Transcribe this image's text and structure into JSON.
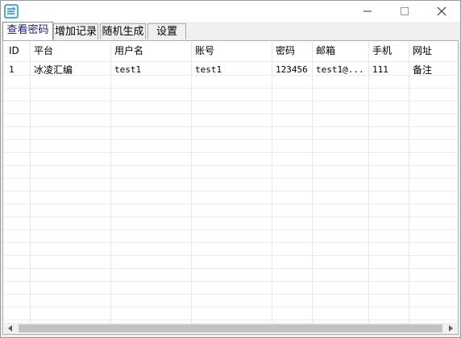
{
  "titlebar": {
    "title": "",
    "icon": "app-icon"
  },
  "tabs": [
    {
      "label": "查看密码",
      "active": true
    },
    {
      "label": "增加记录",
      "active": false
    },
    {
      "label": "随机生成",
      "active": false
    },
    {
      "label": "设置",
      "active": false
    }
  ],
  "table": {
    "columns": [
      "ID",
      "平台",
      "用户名",
      "账号",
      "密码",
      "邮箱",
      "手机",
      "网址"
    ],
    "rows": [
      [
        "1",
        "冰凌汇编",
        "test1",
        "test1",
        "123456",
        "test1@...",
        "111",
        "备注"
      ]
    ]
  },
  "colors": {
    "tab_active_text": "#1a1a6e",
    "grid_line": "#e6e6e6",
    "scroll_thumb": "#c2c2c2"
  }
}
